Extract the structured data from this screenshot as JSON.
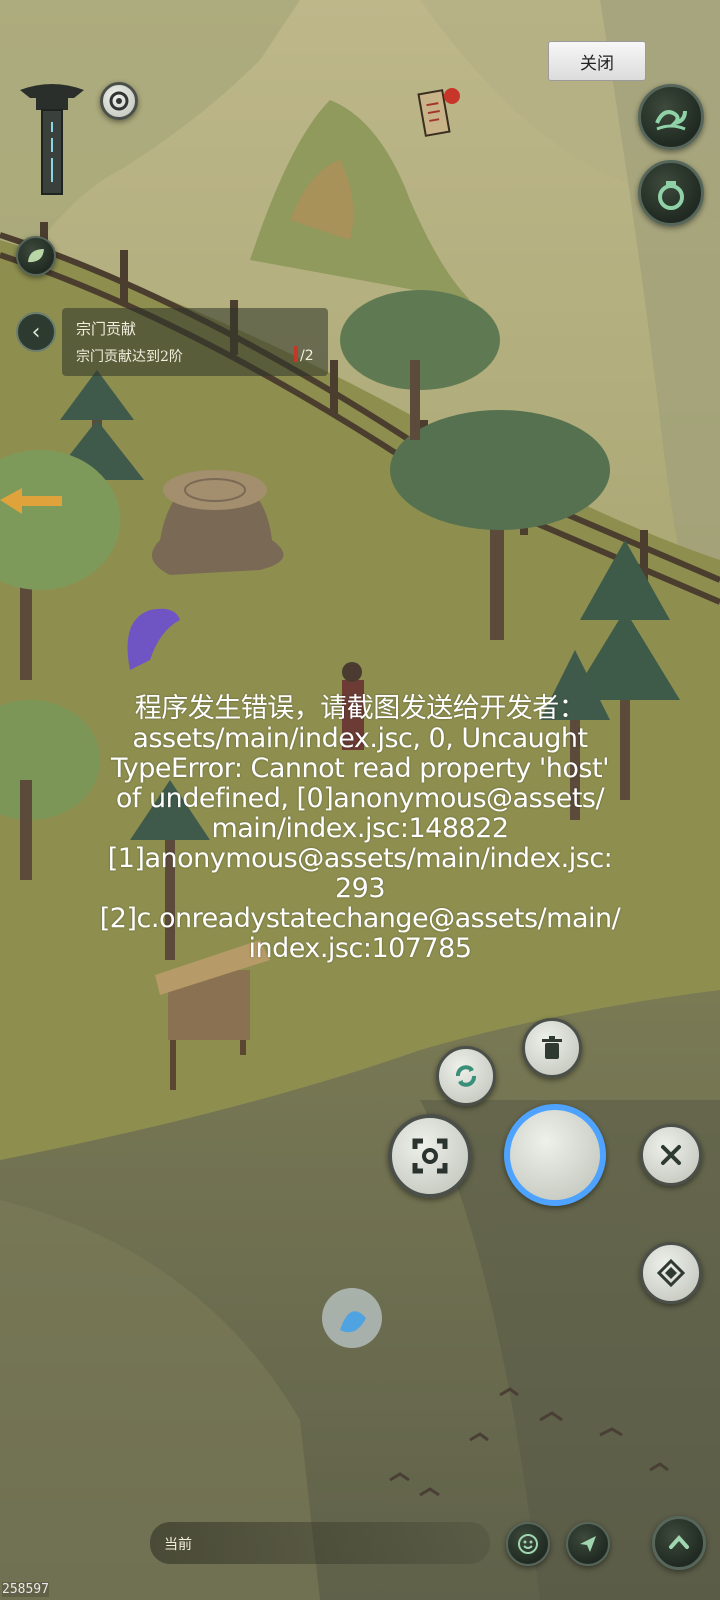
{
  "close_button": {
    "label": "关闭"
  },
  "quest": {
    "title": "宗门贡献",
    "description": "宗门贡献达到2阶",
    "progress": "/2"
  },
  "error": {
    "lines": [
      "程序发生错误，请截图发送给开发者：",
      "assets/main/index.jsc, 0, Uncaught",
      "TypeError: Cannot read property 'host'",
      "of undefined, [0]anonymous@assets/",
      "main/index.jsc:148822",
      "[1]anonymous@assets/main/index.jsc:",
      "293",
      "[2]c.onreadystatechange@assets/main/",
      "index.jsc:107785"
    ]
  },
  "chat": {
    "label": "当前"
  },
  "version_text": "258597",
  "icons": {
    "totem": "sect-totem-icon",
    "compass": "compass-icon",
    "scroll": "scroll-notice-icon",
    "wave": "wave-skill-icon",
    "gourd": "gourd-bag-icon",
    "leaf": "leaf-toggle-icon",
    "refresh": "refresh-icon",
    "trash": "trash-icon",
    "lock_target": "lock-target-icon",
    "joystick": "action-joystick-icon",
    "cancel": "cancel-x-icon",
    "diamond": "diamond-skill-icon",
    "emoji": "emoji-icon",
    "send": "send-icon",
    "expand": "expand-up-icon"
  },
  "colors": {
    "grass": "#8a8c4e",
    "cliff": "#6f6f50",
    "panel_bg": "#2d342a",
    "accent_blue": "#4da3ff",
    "alert_red": "#c0392b"
  }
}
